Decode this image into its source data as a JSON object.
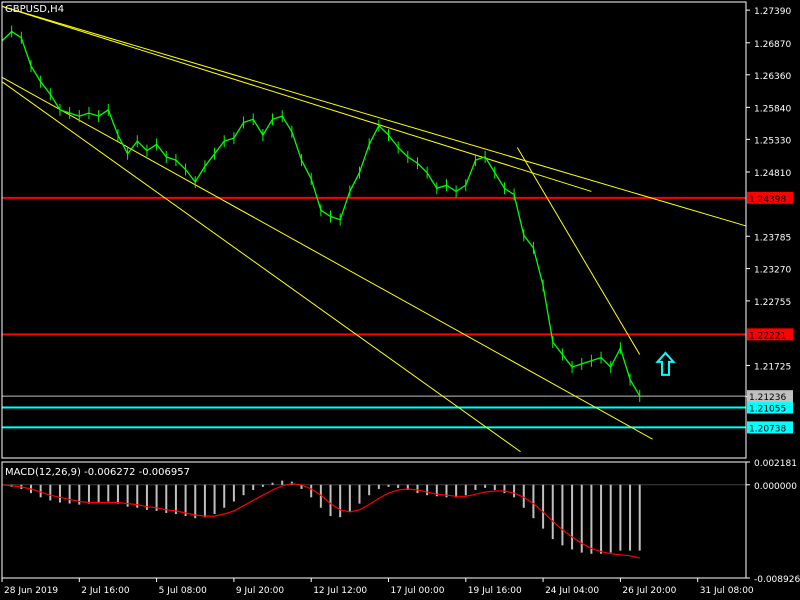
{
  "window": {
    "symbol_label": "GBPUSD,H4"
  },
  "colors": {
    "background": "#000000",
    "text": "#ffffff",
    "frame": "#ffffff",
    "candle": "#00ff00",
    "trendline": "#ffff00",
    "resistance": "#ff0000",
    "support": "#00ffff",
    "arrow": "#00ffff",
    "histogram": "#c0c0c0",
    "signal": "#ff0000",
    "current_price": "#c0c0c0"
  },
  "chart_data": [
    {
      "type": "line",
      "name": "price",
      "ylim": [
        1.2025,
        1.2752
      ],
      "y_ticks": [
        "1.27390",
        "1.26870",
        "1.26360",
        "1.25840",
        "1.25330",
        "1.24810",
        "1.23785",
        "1.23270",
        "1.22755",
        "1.21725",
        "1.21230"
      ],
      "x_ticks": [
        "28 Jun 2019",
        "2 Jul 16:00",
        "5 Jul 08:00",
        "9 Jul 20:00",
        "12 Jul 12:00",
        "17 Jul 00:00",
        "19 Jul 16:00",
        "24 Jul 04:00",
        "26 Jul 20:00",
        "31 Jul 08:00"
      ],
      "x": [
        0,
        3,
        6,
        9,
        12,
        15,
        18,
        21,
        24,
        27,
        30,
        33,
        36,
        39,
        42,
        45,
        48,
        51,
        54,
        57,
        60,
        63,
        66,
        69,
        72,
        75,
        78,
        81,
        84,
        87,
        90,
        93,
        96,
        99,
        102,
        105,
        108,
        111,
        114,
        117,
        120,
        123,
        126,
        129,
        132,
        135,
        138,
        141,
        144,
        147,
        150,
        153,
        156,
        159,
        162,
        165,
        168,
        171,
        174,
        177,
        180,
        183,
        186,
        189,
        192,
        195,
        198
      ],
      "close": [
        1.269,
        1.2705,
        1.2695,
        1.265,
        1.2625,
        1.2605,
        1.258,
        1.2575,
        1.257,
        1.2575,
        1.257,
        1.258,
        1.254,
        1.251,
        1.253,
        1.2515,
        1.2525,
        1.2505,
        1.25,
        1.2485,
        1.2465,
        1.249,
        1.251,
        1.253,
        1.2535,
        1.256,
        1.2565,
        1.254,
        1.2565,
        1.257,
        1.2545,
        1.25,
        1.247,
        1.242,
        1.241,
        1.2405,
        1.245,
        1.248,
        1.2525,
        1.2555,
        1.254,
        1.252,
        1.2505,
        1.2495,
        1.248,
        1.2455,
        1.246,
        1.245,
        1.246,
        1.25,
        1.2505,
        1.248,
        1.2455,
        1.2445,
        1.238,
        1.236,
        1.23,
        1.221,
        1.219,
        1.217,
        1.2175,
        1.218,
        1.2185,
        1.217,
        1.22,
        1.215,
        1.2124
      ],
      "trendlines": [
        {
          "from": [
            0,
            1.2745
          ],
          "to": [
            183,
            1.245
          ]
        },
        {
          "from": [
            0,
            1.2745
          ],
          "to": [
            231,
            1.2395
          ]
        },
        {
          "from": [
            0,
            1.2632
          ],
          "to": [
            202,
            1.2055
          ]
        },
        {
          "from": [
            0,
            1.2625
          ],
          "to": [
            161,
            1.2035
          ]
        },
        {
          "from": [
            160,
            1.252
          ],
          "to": [
            198,
            1.219
          ]
        }
      ],
      "levels": [
        {
          "label": "1.24398",
          "value": 1.24398,
          "kind": "resistance"
        },
        {
          "label": "1.22221",
          "value": 1.22221,
          "kind": "resistance"
        },
        {
          "label": "1.21055",
          "value": 1.21055,
          "kind": "support"
        },
        {
          "label": "1.20738",
          "value": 1.20738,
          "kind": "support"
        }
      ],
      "current_price": {
        "label": "1.21236",
        "value": 1.21236
      },
      "arrow": {
        "x": 206,
        "y": 1.2175,
        "direction": "up"
      }
    },
    {
      "type": "bar",
      "name": "macd",
      "title": "MACD(12,26,9) -0.006272 -0.006957",
      "ylim": [
        -0.008926,
        0.002181
      ],
      "y_ticks": [
        "0.002181",
        "0.000000",
        "-0.008926"
      ],
      "x": [
        0,
        3,
        6,
        9,
        12,
        15,
        18,
        21,
        24,
        27,
        30,
        33,
        36,
        39,
        42,
        45,
        48,
        51,
        54,
        57,
        60,
        63,
        66,
        69,
        72,
        75,
        78,
        81,
        84,
        87,
        90,
        93,
        96,
        99,
        102,
        105,
        108,
        111,
        114,
        117,
        120,
        123,
        126,
        129,
        132,
        135,
        138,
        141,
        144,
        147,
        150,
        153,
        156,
        159,
        162,
        165,
        168,
        171,
        174,
        177,
        180,
        183,
        186,
        189,
        192,
        195,
        198
      ],
      "histogram": [
        0,
        -0.0002,
        -0.0004,
        -0.0008,
        -0.0012,
        -0.0015,
        -0.0017,
        -0.0018,
        -0.0019,
        -0.0018,
        -0.0017,
        -0.0016,
        -0.0018,
        -0.0021,
        -0.0022,
        -0.0024,
        -0.0025,
        -0.0027,
        -0.0028,
        -0.003,
        -0.0032,
        -0.0031,
        -0.0028,
        -0.0022,
        -0.0016,
        -0.001,
        -0.0005,
        -0.0002,
        0.0002,
        0.0004,
        0.0003,
        -0.0004,
        -0.0012,
        -0.0022,
        -0.003,
        -0.0031,
        -0.0026,
        -0.0018,
        -0.001,
        -0.0004,
        -0.0002,
        -0.0003,
        -0.0005,
        -0.0008,
        -0.001,
        -0.0011,
        -0.0012,
        -0.0012,
        -0.001,
        -0.0005,
        -0.0003,
        -0.0005,
        -0.0008,
        -0.0012,
        -0.0022,
        -0.0032,
        -0.0042,
        -0.0052,
        -0.0058,
        -0.0062,
        -0.0065,
        -0.0066,
        -0.0066,
        -0.0065,
        -0.0063,
        -0.0063,
        -0.0063
      ],
      "signal": [
        0,
        -0.0001,
        -0.0002,
        -0.0004,
        -0.0007,
        -0.001,
        -0.0012,
        -0.0014,
        -0.0016,
        -0.0017,
        -0.0017,
        -0.0017,
        -0.0017,
        -0.0018,
        -0.0019,
        -0.0021,
        -0.0022,
        -0.0024,
        -0.0025,
        -0.0027,
        -0.0029,
        -0.003,
        -0.003,
        -0.0028,
        -0.0025,
        -0.002,
        -0.0015,
        -0.001,
        -0.0005,
        -0.0001,
        0.0001,
        0.0,
        -0.0004,
        -0.001,
        -0.0018,
        -0.0024,
        -0.0026,
        -0.0024,
        -0.0019,
        -0.0013,
        -0.0008,
        -0.0005,
        -0.0004,
        -0.0005,
        -0.0007,
        -0.0009,
        -0.001,
        -0.0011,
        -0.0011,
        -0.0009,
        -0.0007,
        -0.0006,
        -0.0006,
        -0.0008,
        -0.0012,
        -0.0018,
        -0.0026,
        -0.0035,
        -0.0043,
        -0.005,
        -0.0056,
        -0.0061,
        -0.0064,
        -0.0066,
        -0.0067,
        -0.0068,
        -0.007
      ]
    }
  ]
}
